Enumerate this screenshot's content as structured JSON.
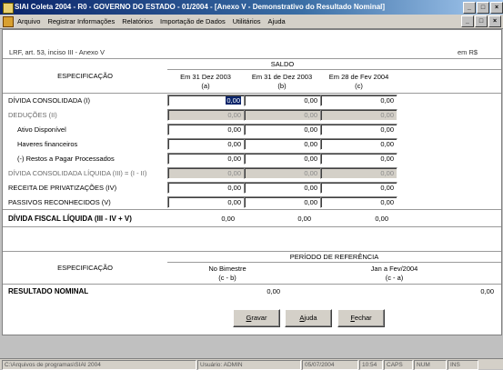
{
  "window": {
    "title": "SIAI Coleta 2004 - R0 - GOVERNO DO ESTADO - 01/2004 - [Anexo V - Demonstrativo do Resultado Nominal]"
  },
  "menu": {
    "items": [
      "Arquivo",
      "Registrar Informações",
      "Relatórios",
      "Importação de Dados",
      "Utilitários",
      "Ajuda"
    ]
  },
  "form": {
    "legal_ref": "LRF, art. 53, inciso III - Anexo V",
    "currency_note": "em R$",
    "spec_header": "ESPECIFICAÇÃO",
    "saldo_header": "SALDO",
    "columns": [
      {
        "line1": "Em 31 Dez 2003",
        "line2": "(a)"
      },
      {
        "line1": "Em 31 de Dez 2003",
        "line2": "(b)"
      },
      {
        "line1": "Em 28 de Fev 2004",
        "line2": "(c)"
      }
    ],
    "rows": [
      {
        "label": "DÍVIDA CONSOLIDADA (I)",
        "values": [
          "0,00",
          "0,00",
          "0,00"
        ]
      },
      {
        "label": "DEDUÇÕES (II)",
        "values": [
          "0,00",
          "0,00",
          "0,00"
        ]
      },
      {
        "label": "Ativo Disponível",
        "values": [
          "0,00",
          "0,00",
          "0,00"
        ]
      },
      {
        "label": "Haveres financeiros",
        "values": [
          "0,00",
          "0,00",
          "0,00"
        ]
      },
      {
        "label": "(-) Restos a Pagar Processados",
        "values": [
          "0,00",
          "0,00",
          "0,00"
        ]
      },
      {
        "label": "DÍVIDA CONSOLIDADA LÍQUIDA (III) = (I - II)",
        "values": [
          "0,00",
          "0,00",
          "0,00"
        ]
      },
      {
        "label": "RECEITA DE PRIVATIZAÇÕES (IV)",
        "values": [
          "0,00",
          "0,00",
          "0,00"
        ]
      },
      {
        "label": "PASSIVOS RECONHECIDOS (V)",
        "values": [
          "0,00",
          "0,00",
          "0,00"
        ]
      }
    ],
    "total_row": {
      "label": "DÍVIDA FISCAL LÍQUIDA (III - IV + V)",
      "values": [
        "0,00",
        "0,00",
        "0,00"
      ]
    }
  },
  "result": {
    "spec_header": "ESPECIFICAÇÃO",
    "period_header": "PERÍODO DE REFERÊNCIA",
    "columns": [
      {
        "line1": "No Bimestre",
        "line2": "(c - b)"
      },
      {
        "line1": "Jan a Fev/2004",
        "line2": "(c - a)"
      }
    ],
    "row": {
      "label": "RESULTADO NOMINAL",
      "values": [
        "0,00",
        "0,00"
      ]
    }
  },
  "buttons": {
    "save": "Gravar",
    "help": "Ajuda",
    "close": "Fechar"
  },
  "statusbar": {
    "message": "C:\\Arquivos de programas\\SIAI 2004",
    "user": "Usuário: ADMIN",
    "date": "05/07/2004",
    "time": "10:54",
    "caps": "CAPS",
    "num": "NUM",
    "ins": "INS"
  }
}
